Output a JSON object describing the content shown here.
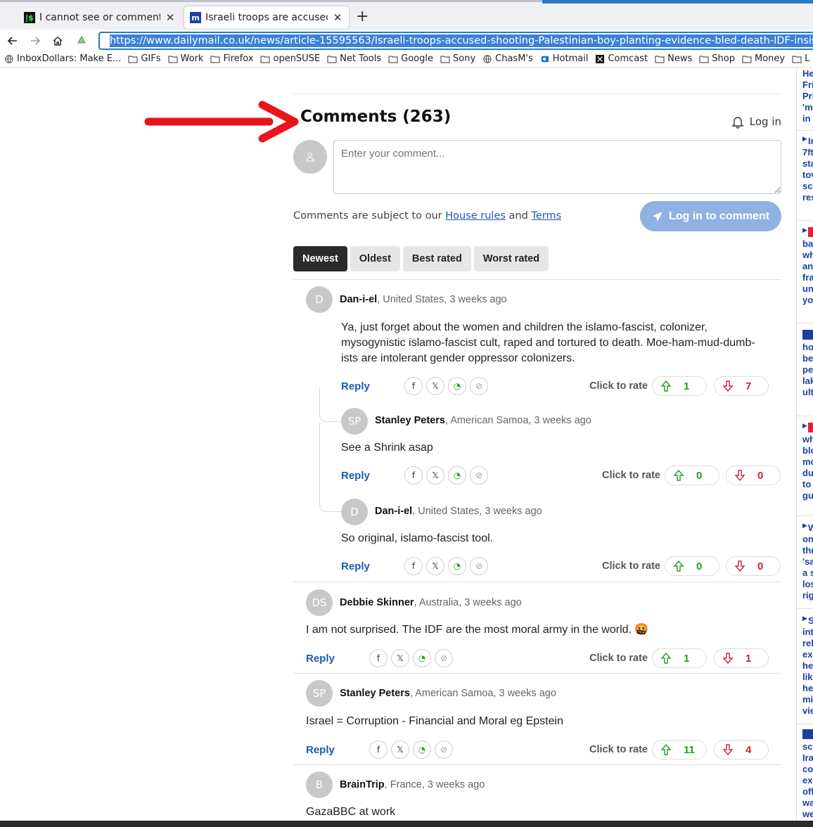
{
  "browser": {
    "tabs": [
      {
        "label": "I cannot see or comment in \"",
        "favicon": "terminal-favicon"
      },
      {
        "label": "Israeli troops are accused of",
        "favicon": "dailymail-favicon"
      }
    ],
    "url": "https://www.dailymail.co.uk/news/article-15595563/Israeli-troops-accused-shooting-Palestinian-boy-planting-evidence-bled-death-IDF-insists-teen-t",
    "bookmarks": [
      "InboxDollars: Make E...",
      "GIFs",
      "Work",
      "Firefox",
      "openSUSE",
      "Net Tools",
      "Google",
      "Sony",
      "ChasM's",
      "Hotmail",
      "Comcast",
      "News",
      "Shop",
      "Money",
      "L"
    ]
  },
  "comments_section": {
    "title": "Comments (263)",
    "login_label": "Log in",
    "input_placeholder": "Enter your comment...",
    "rules_prefix": "Comments are subject to our ",
    "house_rules": "House rules",
    "rules_and": " and ",
    "terms": "Terms",
    "login_button": "Log in to comment",
    "sort_tabs": [
      "Newest",
      "Oldest",
      "Best rated",
      "Worst rated"
    ],
    "active_sort": "Newest",
    "reply_label": "Reply",
    "rate_label": "Click to rate"
  },
  "comments": [
    {
      "initials": "D",
      "author": "Dan-i-el",
      "meta": ", United States, 3 weeks ago",
      "text": "Ya, just forget about the women and children the islamo-fascist, colonizer, mysogynistic islamo-fascist cult, raped and tortured to death. Moe-ham-mud-dumb-ists are intolerant gender oppressor colonizers.",
      "up": "1",
      "down": "7"
    },
    {
      "initials": "SP",
      "author": "Stanley Peters",
      "meta": ", American Samoa, 3 weeks ago",
      "text": "See a Shrink asap",
      "up": "0",
      "down": "0"
    },
    {
      "initials": "D",
      "author": "Dan-i-el",
      "meta": ", United States, 3 weeks ago",
      "text": "So original, islamo-fascist tool.",
      "up": "0",
      "down": "0"
    },
    {
      "initials": "DS",
      "author": "Debbie Skinner",
      "meta": ", Australia, 3 weeks ago",
      "text": "I am not surprised. The IDF are the most moral army in the world. 🤬",
      "up": "1",
      "down": "1"
    },
    {
      "initials": "SP",
      "author": "Stanley Peters",
      "meta": ", American Samoa, 3 weeks ago",
      "text": "Israel = Corruption - Financial and Moral eg Epstein",
      "up": "11",
      "down": "4"
    },
    {
      "initials": "B",
      "author": "BrainTrip",
      "meta": ", France, 3 weeks ago",
      "text": "GazaBBC at work"
    }
  ],
  "sidebar_snippets": [
    [
      "He",
      "Fri",
      "Pri",
      "'m",
      "in"
    ],
    [
      "In",
      "7ft",
      "sta",
      "tov",
      "sc",
      "res"
    ],
    [
      "ba",
      "wh",
      "an",
      "fra",
      "un",
      "yo"
    ],
    [
      "ho",
      "be",
      "pe",
      "lak",
      "ult"
    ],
    [
      "wh",
      "blo",
      "mo",
      "du",
      "to",
      "gu"
    ],
    [
      "W",
      "on",
      "thr",
      "'sa",
      "a s",
      "los",
      "rig"
    ],
    [
      "S",
      "int",
      "rel",
      "ex",
      "he",
      "lik",
      "he",
      "mi",
      "vie"
    ],
    [
      "sc",
      "Ira",
      "co",
      "ex",
      "off",
      "wa",
      "we"
    ]
  ],
  "colors": {
    "accent": "#1a5bb5",
    "login_button": "#8fb1e3",
    "upvote": "#1ea01e",
    "downvote": "#d0203a",
    "arrow": "#e8141a"
  }
}
